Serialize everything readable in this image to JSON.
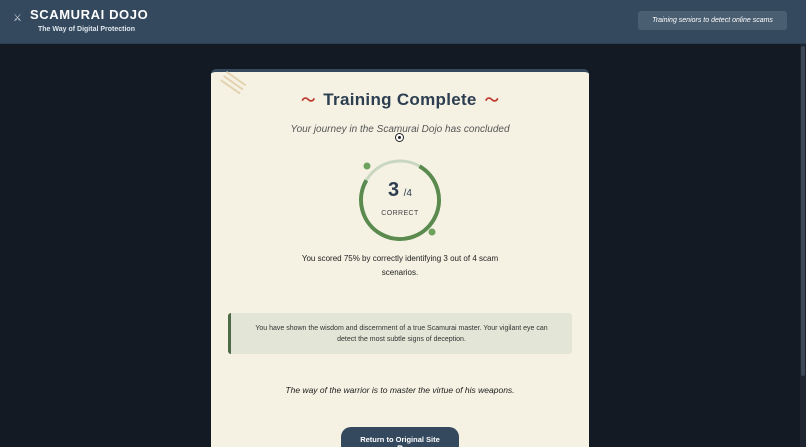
{
  "header": {
    "logo_icon": "sword-icon",
    "logo_glyph": "⚔",
    "title": "SCAMURAI DOJO",
    "subtitle": "The Way of Digital Protection",
    "tagline": "Training seniors to detect online scams"
  },
  "result": {
    "title": "Training Complete",
    "subtitle": "Your journey in the Scamurai Dojo has concluded",
    "score": "3",
    "total": "/4",
    "score_fraction": 0.75,
    "score_label": "CORRECT",
    "summary": "You scored 75% by correctly identifying 3 out of 4 scam scenarios.",
    "wisdom": "You have shown the wisdom and discernment of a true Scamurai master. Your vigilant eye can detect the most subtle signs of deception.",
    "quote": "The way of the warrior is to master the virtue of his weapons.",
    "return_button": "Return to Original Site",
    "return_icon_glyph": "⧉"
  },
  "colors": {
    "header_bg": "#34495e",
    "card_bg": "#f5f2e4",
    "accent_green": "#5a8a4e",
    "accent_red": "#c0392b"
  }
}
